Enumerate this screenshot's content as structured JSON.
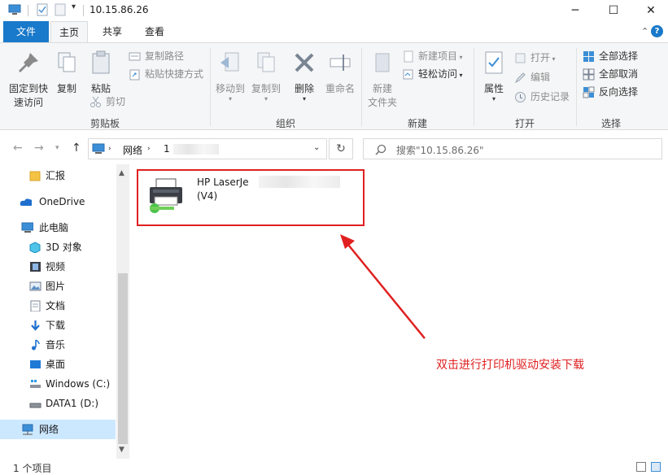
{
  "window": {
    "title": "10.15.86.26",
    "minimize": "─",
    "maximize": "☐",
    "close": "✕"
  },
  "ribbon_tabs": {
    "file": "文件",
    "home": "主页",
    "share": "共享",
    "view": "查看"
  },
  "ribbon": {
    "clipboard": {
      "group_label": "剪贴板",
      "pin_label_1": "固定到快",
      "pin_label_2": "速访问",
      "copy": "复制",
      "paste": "粘贴",
      "copy_path": "复制路径",
      "paste_shortcut": "粘贴快捷方式",
      "cut": "剪切"
    },
    "organize": {
      "group_label": "组织",
      "move_to": "移动到",
      "copy_to": "复制到",
      "delete": "删除",
      "rename": "重命名"
    },
    "new": {
      "group_label": "新建",
      "new_folder_1": "新建",
      "new_folder_2": "文件夹",
      "new_item": "新建项目",
      "easy_access": "轻松访问"
    },
    "open": {
      "group_label": "打开",
      "properties": "属性",
      "open": "打开",
      "edit": "编辑",
      "history": "历史记录"
    },
    "select": {
      "group_label": "选择",
      "select_all": "全部选择",
      "select_none": "全部取消",
      "invert": "反向选择"
    }
  },
  "address": {
    "crumb_root": "网络",
    "crumb_host": "1",
    "search_placeholder": "搜索\"10.15.86.26\""
  },
  "nav": {
    "items": [
      {
        "label": "汇报",
        "icon": "folder-icon"
      },
      {
        "label": "OneDrive",
        "icon": "cloud-icon"
      },
      {
        "label": "此电脑",
        "icon": "computer-icon"
      },
      {
        "label": "3D 对象",
        "icon": "3d-objects-icon"
      },
      {
        "label": "视频",
        "icon": "video-icon"
      },
      {
        "label": "图片",
        "icon": "pictures-icon"
      },
      {
        "label": "文档",
        "icon": "documents-icon"
      },
      {
        "label": "下载",
        "icon": "download-icon"
      },
      {
        "label": "音乐",
        "icon": "music-icon"
      },
      {
        "label": "桌面",
        "icon": "desktop-icon"
      },
      {
        "label": "Windows (C:)",
        "icon": "drive-icon"
      },
      {
        "label": "DATA1 (D:)",
        "icon": "drive-icon"
      },
      {
        "label": "网络",
        "icon": "network-icon"
      }
    ]
  },
  "content": {
    "printer_name_line1": "HP LaserJe",
    "printer_name_line2": "(V4)",
    "annotation": "双击进行打印机驱动安装下载"
  },
  "status": {
    "item_count": "1 个项目"
  },
  "colors": {
    "accent": "#1979ca",
    "annotation_red": "#e02020",
    "ribbon_bg": "#f5f6f7",
    "nav_selected": "#cce8ff"
  }
}
